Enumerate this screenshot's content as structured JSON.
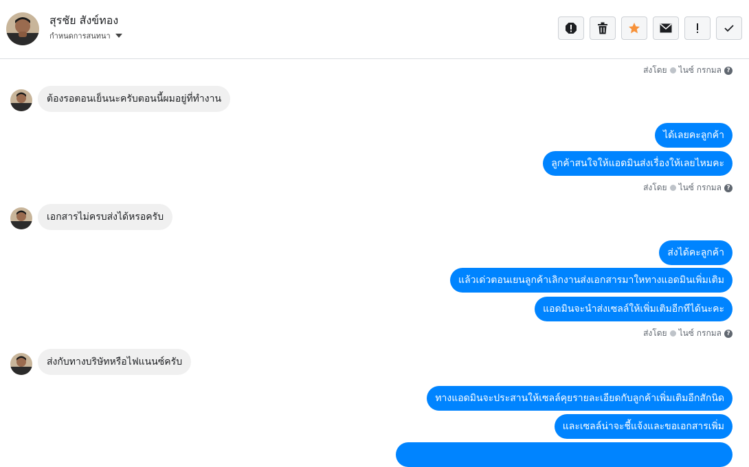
{
  "header": {
    "name": "สุรชัย สังข์ทอง",
    "subtitle": "กำหนดการสนทนา",
    "toolbar": [
      {
        "icon": "alert-octagon-icon",
        "name": "spam-button"
      },
      {
        "icon": "trash-icon",
        "name": "delete-button"
      },
      {
        "icon": "star-icon",
        "name": "star-button",
        "color": "#f7923a"
      },
      {
        "icon": "envelope-icon",
        "name": "mark-unread-button"
      },
      {
        "icon": "exclamation-icon",
        "name": "follow-up-button"
      },
      {
        "icon": "check-icon",
        "name": "done-button"
      }
    ]
  },
  "colors": {
    "outgoing_bubble": "#0084ff",
    "incoming_bubble": "#f0f0f0",
    "star": "#f7923a"
  },
  "messages": [
    {
      "type": "meta",
      "prefix": "ส่งโดย",
      "sender": "ไนซ์ กรกมล"
    },
    {
      "type": "in",
      "text": "ต้องรอตอนเย็นนะครับตอนนี้ผมอยู่ที่ทำงาน"
    },
    {
      "type": "out",
      "text": "ได้เลยคะลูกค้า"
    },
    {
      "type": "out",
      "text": "ลูกค้าสนใจให้แอดมินส่งเรื่องให้เลยไหมคะ"
    },
    {
      "type": "meta",
      "prefix": "ส่งโดย",
      "sender": "ไนซ์ กรกมล"
    },
    {
      "type": "in",
      "text": "เอกสารไม่ครบส่งได้หรอครับ"
    },
    {
      "type": "out",
      "text": "ส่งได้คะลูกค้า"
    },
    {
      "type": "out",
      "text": "แล้วเด่วตอนเยนลูกค้าเลิกงานส่งเอกสารมาใหทางแอดมินเพิ่มเติม"
    },
    {
      "type": "out",
      "text": "แอดมินจะนำส่งเซลล์ให้เพิ่มเติมอีกทีได้นะคะ"
    },
    {
      "type": "meta",
      "prefix": "ส่งโดย",
      "sender": "ไนซ์ กรกมล"
    },
    {
      "type": "in",
      "text": "ส่งกับทางบริษัทหรือไฟแนนซ์ครับ"
    },
    {
      "type": "out",
      "text": "ทางแอดมินจะประสานให้เซลล์คุยรายละเอียดกับลูกค้าเพิ่มเติมอีกสักนิด"
    },
    {
      "type": "out",
      "text": "และเซลล์น่าจะชี้แจ้งและขอเอกสารเพิ่ม"
    }
  ]
}
